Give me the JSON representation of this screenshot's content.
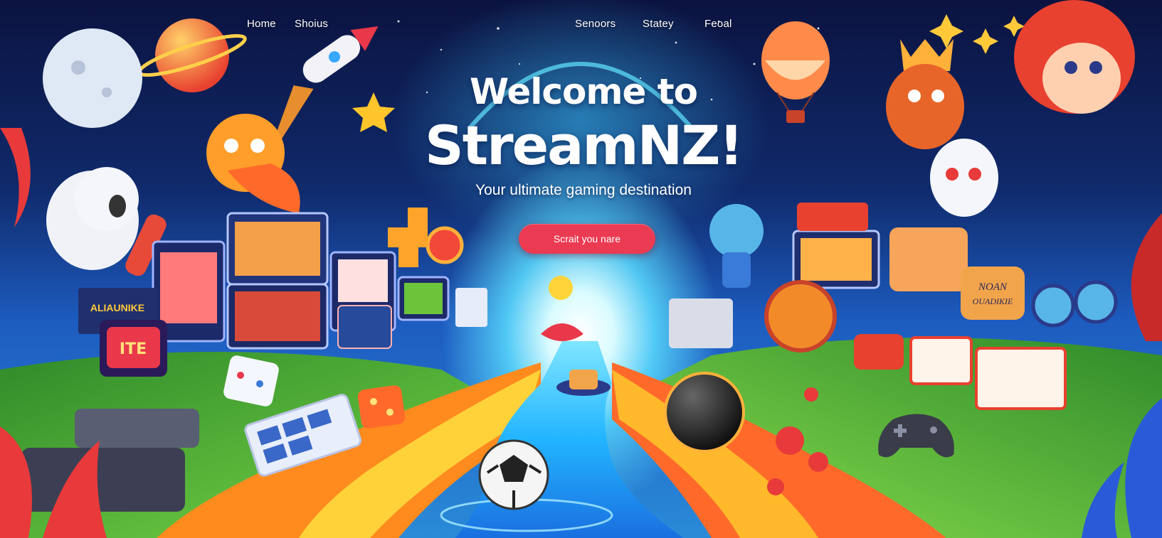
{
  "nav": {
    "items": [
      {
        "label": "Home"
      },
      {
        "label": "Shoius"
      },
      {
        "label": "Senoors"
      },
      {
        "label": "Statey"
      },
      {
        "label": "Feoal"
      }
    ]
  },
  "hero": {
    "title_line1": "Welcome to",
    "title_line2": "StreamNZ!",
    "subtitle": "Your ultimate gaming destination",
    "cta_label": "Scrait you nare"
  },
  "illustration": {
    "left_sign_text": "ALIAUNIKE",
    "left_badge_text": "ITE",
    "right_sign_text": "NOAN",
    "right_sign_text2": "OUADIKIE"
  },
  "colors": {
    "cta": "#ea3b52",
    "sky_top": "#0b1340",
    "river": "#1eb0ff",
    "grass": "#4fc43a",
    "path_orange": "#ffae1a"
  }
}
